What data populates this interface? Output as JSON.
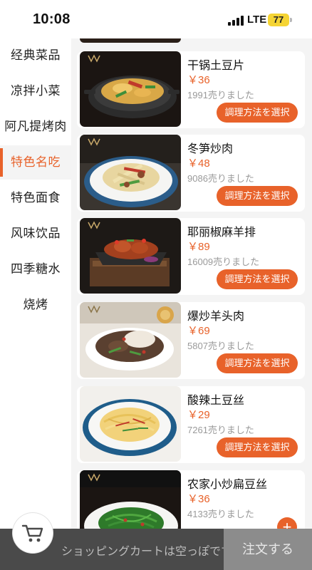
{
  "status_bar": {
    "time": "10:08",
    "network": "LTE",
    "battery": "77"
  },
  "sidebar": {
    "active_index": 3,
    "items": [
      {
        "label": "经典菜品"
      },
      {
        "label": "凉拌小菜"
      },
      {
        "label": "阿凡提烤肉"
      },
      {
        "label": "特色名吃"
      },
      {
        "label": "特色面食"
      },
      {
        "label": "风味饮品"
      },
      {
        "label": "四季糖水"
      },
      {
        "label": "烧烤"
      }
    ]
  },
  "menu": {
    "choose_label": "調理方法を選択",
    "dishes": [
      {
        "name": "干锅土豆片",
        "price": "￥36",
        "sold": "1991売りました"
      },
      {
        "name": "冬笋炒肉",
        "price": "￥48",
        "sold": "9086売りました"
      },
      {
        "name": "耶丽椒麻羊排",
        "price": "￥89",
        "sold": "16009売りました"
      },
      {
        "name": "爆炒羊头肉",
        "price": "￥69",
        "sold": "5807売りました"
      },
      {
        "name": "酸辣土豆丝",
        "price": "￥29",
        "sold": "7261売りました"
      },
      {
        "name": "农家小炒扁豆丝",
        "price": "￥36",
        "sold": "4133売りました"
      }
    ],
    "add_icon": "plus-icon"
  },
  "cart": {
    "icon": "cart-icon",
    "empty_text": "ショッピングカートは空っぽです",
    "order_label": "注文する"
  },
  "colors": {
    "accent": "#e8622a",
    "bottom_bar": "#4a4a4a",
    "order_button": "#8c8c8c"
  }
}
